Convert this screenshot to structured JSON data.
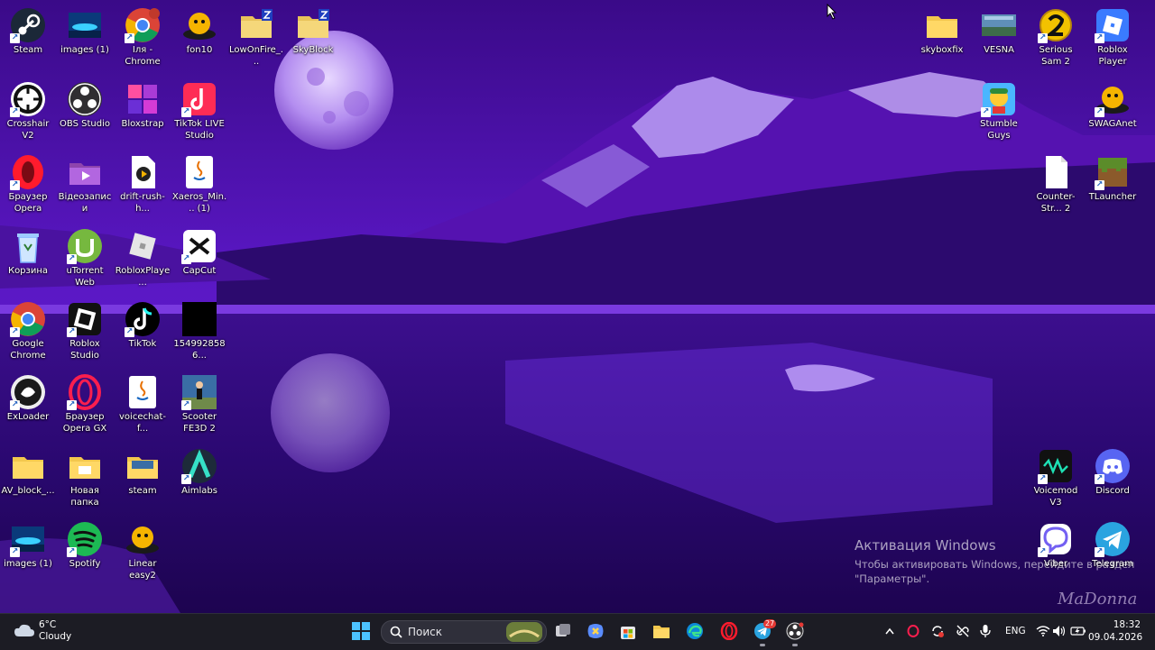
{
  "desktop": {
    "icons": [
      {
        "label": "Steam",
        "icon": "steam-icon",
        "color": "#1b2838"
      },
      {
        "label": "images (1)",
        "icon": "image-file-icon",
        "color": "#0a3a7a"
      },
      {
        "label": "Іля - Chrome",
        "icon": "chrome-profile-icon",
        "color": "#db4437"
      },
      {
        "label": "fon10",
        "icon": "fon10-icon",
        "color": "#f5b400"
      },
      {
        "label": "LowOnFire_...",
        "icon": "zip-folder-icon",
        "color": "#e8c25a"
      },
      {
        "label": "SkyBlock",
        "icon": "zip-folder-icon",
        "color": "#e8c25a"
      },
      {
        "label": "Crosshair V2",
        "icon": "crosshair-icon",
        "color": "#111111"
      },
      {
        "label": "OBS Studio",
        "icon": "obs-icon",
        "color": "#302e31"
      },
      {
        "label": "Bloxstrap",
        "icon": "bloxstrap-icon",
        "color": "#a93bd6"
      },
      {
        "label": "TikTok LIVE Studio",
        "icon": "tiktok-live-icon",
        "color": "#fe2c55"
      },
      {
        "label": "Браузер Opera",
        "icon": "opera-icon",
        "color": "#ff1b2d"
      },
      {
        "label": "Відеозаписи",
        "icon": "videos-folder-icon",
        "color": "#8e44ad"
      },
      {
        "label": "drift-rush-h...",
        "icon": "media-file-icon",
        "color": "#ffffff"
      },
      {
        "label": "Xaeros_Min... (1)",
        "icon": "java-file-icon",
        "color": "#ffffff"
      },
      {
        "label": "Корзина",
        "icon": "recycle-bin-icon",
        "color": "#9ecbff"
      },
      {
        "label": "uTorrent Web",
        "icon": "utorrent-icon",
        "color": "#76b83f"
      },
      {
        "label": "RobloxPlaye...",
        "icon": "roblox-player-icon",
        "color": "#e6e6e6"
      },
      {
        "label": "CapCut",
        "icon": "capcut-icon",
        "color": "#ffffff"
      },
      {
        "label": "Google Chrome",
        "icon": "chrome-icon",
        "color": "#db4437"
      },
      {
        "label": "Roblox Studio",
        "icon": "roblox-studio-icon",
        "color": "#111111"
      },
      {
        "label": "TikTok",
        "icon": "tiktok-icon",
        "color": "#000000"
      },
      {
        "label": "1549928586...",
        "icon": "black-image-icon",
        "color": "#000000"
      },
      {
        "label": "ExLoader",
        "icon": "exloader-icon",
        "color": "#1a1a1a"
      },
      {
        "label": "Браузер Opera GX",
        "icon": "opera-gx-icon",
        "color": "#fa1e4e"
      },
      {
        "label": "voicechat-f...",
        "icon": "java-file-icon",
        "color": "#ffffff"
      },
      {
        "label": "Scooter FE3D 2",
        "icon": "scooter-game-icon",
        "color": "#3a6ea5"
      },
      {
        "label": "AV_block_...",
        "icon": "folder-icon",
        "color": "#f3c74d"
      },
      {
        "label": "Новая папка",
        "icon": "folder-icon",
        "color": "#f3c74d"
      },
      {
        "label": "steam",
        "icon": "folder-image-icon",
        "color": "#f3c74d"
      },
      {
        "label": "Aimlabs",
        "icon": "aimlabs-icon",
        "color": "#1d2b3a"
      },
      {
        "label": "images (1)",
        "icon": "image-file-icon",
        "color": "#0a3a7a"
      },
      {
        "label": "Spotify",
        "icon": "spotify-icon",
        "color": "#1db954"
      },
      {
        "label": "Linear easy2",
        "icon": "linear-easy-icon",
        "color": "#f5b400"
      },
      {
        "label": "skyboxfix",
        "icon": "folder-icon",
        "color": "#f3c74d"
      },
      {
        "label": "VESNA",
        "icon": "vesna-image-icon",
        "color": "#5f8fb7"
      },
      {
        "label": "Serious Sam 2",
        "icon": "serious-sam-icon",
        "color": "#f2c200"
      },
      {
        "label": "Roblox Player",
        "icon": "roblox-player-blue-icon",
        "color": "#3a7bff"
      },
      {
        "label": "Stumble Guys",
        "icon": "stumble-guys-icon",
        "color": "#4ab6ff"
      },
      {
        "label": "SWAGAnet",
        "icon": "swaganet-icon",
        "color": "#f5b400"
      },
      {
        "label": "Counter-Str... 2",
        "icon": "blank-file-icon",
        "color": "#ffffff"
      },
      {
        "label": "TLauncher",
        "icon": "tlauncher-icon",
        "color": "#5b8c2a"
      },
      {
        "label": "Voicemod V3",
        "icon": "voicemod-icon",
        "color": "#111111"
      },
      {
        "label": "Discord",
        "icon": "discord-icon",
        "color": "#5865f2"
      },
      {
        "label": "Viber",
        "icon": "viber-icon",
        "color": "#7360f2"
      },
      {
        "label": "Telegram",
        "icon": "telegram-icon",
        "color": "#2aa3e0"
      }
    ]
  },
  "activation": {
    "title": "Активация Windows",
    "line1": "Чтобы активировать Windows, перейдите в раздел",
    "line2": "\"Параметры\"."
  },
  "signature": "MaDonna",
  "taskbar": {
    "weather": {
      "temp": "6°C",
      "condition": "Cloudy"
    },
    "search_placeholder": "Поиск",
    "chrome_badge": "27",
    "language": "ENG",
    "time": "18:32",
    "date": "09.04.2026",
    "accent": "#0078d4"
  }
}
